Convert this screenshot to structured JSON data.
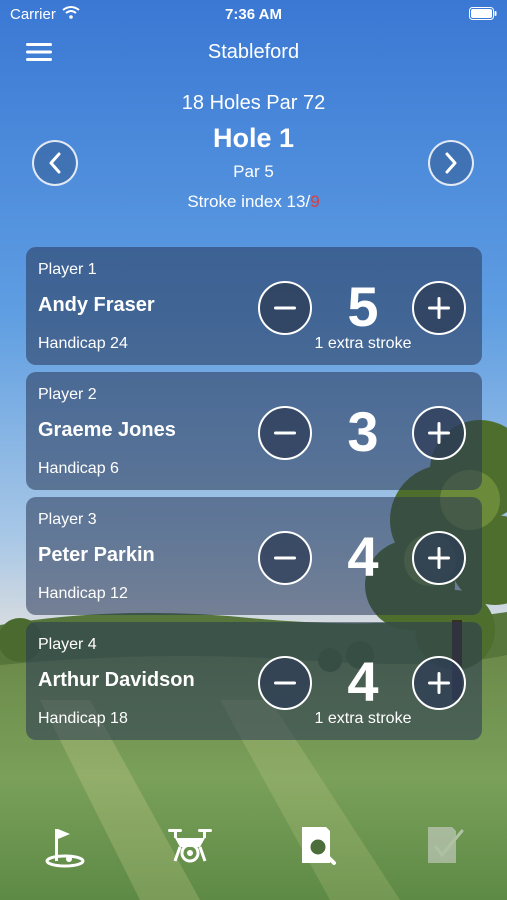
{
  "status_bar": {
    "carrier": "Carrier",
    "time": "7:36 AM"
  },
  "nav": {
    "title": "Stableford",
    "menu_icon": "hamburger-icon"
  },
  "hole": {
    "course": "18 Holes Par 72",
    "title": "Hole 1",
    "par": "Par 5",
    "stroke_index_prefix": "Stroke index 13/",
    "stroke_index_highlight": "9",
    "highlight_color": "#e23b3b"
  },
  "players": [
    {
      "label": "Player 1",
      "name": "Andy Fraser",
      "handicap": "Handicap 24",
      "score": "5",
      "extra": "1 extra stroke"
    },
    {
      "label": "Player 2",
      "name": "Graeme Jones",
      "handicap": "Handicap 6",
      "score": "3",
      "extra": ""
    },
    {
      "label": "Player 3",
      "name": "Peter Parkin",
      "handicap": "Handicap 12",
      "score": "4",
      "extra": ""
    },
    {
      "label": "Player 4",
      "name": "Arthur Davidson",
      "handicap": "Handicap 18",
      "score": "4",
      "extra": "1 extra stroke"
    }
  ],
  "tabs": [
    {
      "icon": "golf-flag-icon",
      "active": true
    },
    {
      "icon": "drone-icon",
      "active": true
    },
    {
      "icon": "search-document-icon",
      "active": true
    },
    {
      "icon": "scorecard-check-icon",
      "active": false
    }
  ]
}
